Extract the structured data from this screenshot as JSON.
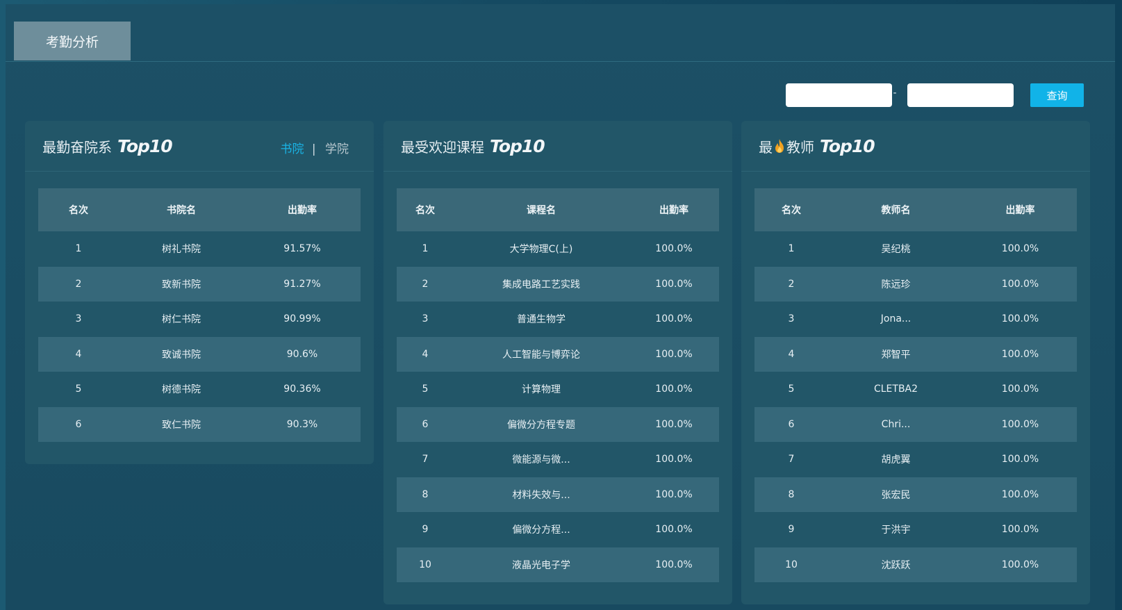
{
  "tab": {
    "label": "考勤分析"
  },
  "filter": {
    "start_value": "",
    "end_value": "",
    "separator": "-",
    "query_label": "查询"
  },
  "panels": {
    "college": {
      "title": "最勤奋院系",
      "badge": "Top10",
      "switch": {
        "active": "书院",
        "divider": "|",
        "inactive": "学院"
      },
      "headers": [
        "名次",
        "书院名",
        "出勤率"
      ],
      "rows": [
        [
          "1",
          "树礼书院",
          "91.57%"
        ],
        [
          "2",
          "致新书院",
          "91.27%"
        ],
        [
          "3",
          "树仁书院",
          "90.99%"
        ],
        [
          "4",
          "致诚书院",
          "90.6%"
        ],
        [
          "5",
          "树德书院",
          "90.36%"
        ],
        [
          "6",
          "致仁书院",
          "90.3%"
        ]
      ]
    },
    "course": {
      "title": "最受欢迎课程",
      "badge": "Top10",
      "headers": [
        "名次",
        "课程名",
        "出勤率"
      ],
      "rows": [
        [
          "1",
          "大学物理C(上)",
          "100.0%"
        ],
        [
          "2",
          "集成电路工艺实践",
          "100.0%"
        ],
        [
          "3",
          "普通生物学",
          "100.0%"
        ],
        [
          "4",
          "人工智能与博弈论",
          "100.0%"
        ],
        [
          "5",
          "计算物理",
          "100.0%"
        ],
        [
          "6",
          "偏微分方程专题",
          "100.0%"
        ],
        [
          "7",
          "微能源与微...",
          "100.0%"
        ],
        [
          "8",
          "材料失效与...",
          "100.0%"
        ],
        [
          "9",
          "偏微分方程...",
          "100.0%"
        ],
        [
          "10",
          "液晶光电子学",
          "100.0%"
        ]
      ]
    },
    "teacher": {
      "title_prefix": "最",
      "title_suffix": "教师",
      "icon": "flame-icon",
      "badge": "Top10",
      "headers": [
        "名次",
        "教师名",
        "出勤率"
      ],
      "rows": [
        [
          "1",
          "吴纪桃",
          "100.0%"
        ],
        [
          "2",
          "陈远珍",
          "100.0%"
        ],
        [
          "3",
          "Jona...",
          "100.0%"
        ],
        [
          "4",
          "郑智平",
          "100.0%"
        ],
        [
          "5",
          "CLETBA2",
          "100.0%"
        ],
        [
          "6",
          "Chri...",
          "100.0%"
        ],
        [
          "7",
          "胡虎翼",
          "100.0%"
        ],
        [
          "8",
          "张宏民",
          "100.0%"
        ],
        [
          "9",
          "于洪宇",
          "100.0%"
        ],
        [
          "10",
          "沈跃跃",
          "100.0%"
        ]
      ]
    }
  },
  "colors": {
    "accent": "#11b3e8",
    "panel_bg": "#225668",
    "stripe": "#36687a",
    "header_row": "#3a6878",
    "flame": "#f0a020"
  }
}
